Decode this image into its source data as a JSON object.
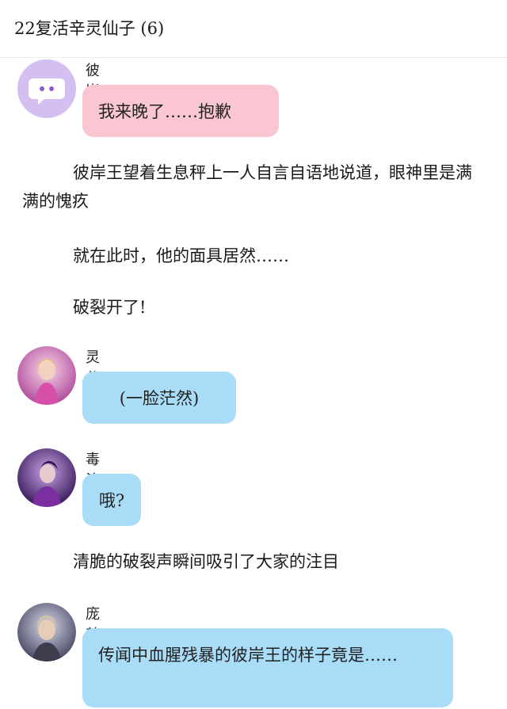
{
  "header": {
    "title": "22复活辛灵仙子 (6)"
  },
  "messages": [
    {
      "name": "彼岸王",
      "text": "我来晚了……抱歉"
    },
    {
      "name": "灵公主",
      "text": "(一脸茫然)"
    },
    {
      "name": "毒汐绯",
      "text": "哦?"
    },
    {
      "name": "庞尊",
      "text": "传闻中血腥残暴的彼岸王的样子竟是……"
    }
  ],
  "narration": [
    "彼岸王望着生息秤上一人自言自语地说道，眼神里是满满的愧疚",
    "就在此时，他的面具居然……",
    "破裂开了!",
    "清脆的破裂声瞬间吸引了大家的注目"
  ]
}
